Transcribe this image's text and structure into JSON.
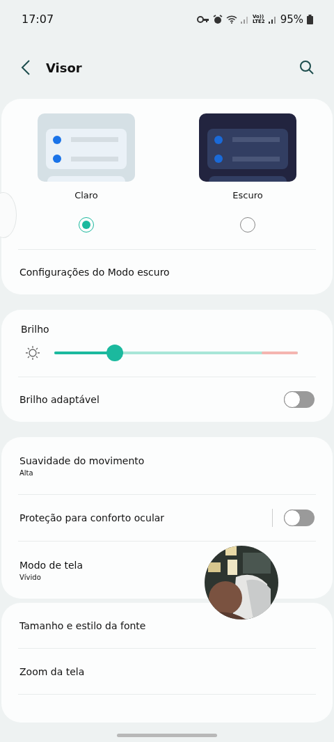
{
  "status_bar": {
    "time": "17:07",
    "network": [
      "Vo))",
      "LTE2"
    ],
    "battery": "95%"
  },
  "header": {
    "title": "Visor"
  },
  "theme": {
    "options": [
      {
        "label": "Claro",
        "kind": "light",
        "selected": true
      },
      {
        "label": "Escuro",
        "kind": "dark",
        "selected": false
      }
    ],
    "settings_link": "Configurações do Modo escuro"
  },
  "brightness": {
    "label": "Brilho",
    "level": 0.23,
    "adaptive": {
      "label": "Brilho adaptável",
      "on": false
    }
  },
  "groups": [
    [
      {
        "kind": "value",
        "title": "Suavidade do movimento",
        "value": "Alta"
      },
      {
        "kind": "toggle",
        "title": "Proteção para conforto ocular",
        "on": false
      },
      {
        "kind": "value",
        "title": "Modo de tela",
        "value": "Vívido"
      }
    ],
    [
      {
        "kind": "link",
        "title": "Tamanho e estilo da fonte"
      },
      {
        "kind": "link",
        "title": "Zoom da tela"
      },
      {
        "kind": "blank"
      }
    ]
  ]
}
